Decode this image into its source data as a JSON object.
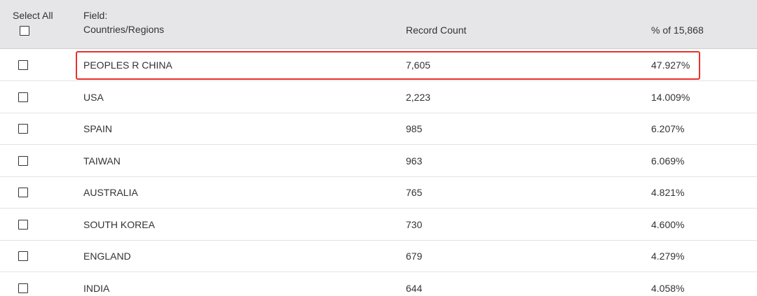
{
  "header": {
    "select_all": "Select All",
    "field_line1": "Field:",
    "field_line2": "Countries/Regions",
    "record_count": "Record Count",
    "percent": "% of 15,868"
  },
  "rows": [
    {
      "name": "PEOPLES R CHINA",
      "count": "7,605",
      "percent": "47.927%",
      "highlighted": true
    },
    {
      "name": "USA",
      "count": "2,223",
      "percent": "14.009%"
    },
    {
      "name": "SPAIN",
      "count": "985",
      "percent": "6.207%"
    },
    {
      "name": "TAIWAN",
      "count": "963",
      "percent": "6.069%"
    },
    {
      "name": "AUSTRALIA",
      "count": "765",
      "percent": "4.821%"
    },
    {
      "name": "SOUTH KOREA",
      "count": "730",
      "percent": "4.600%"
    },
    {
      "name": "ENGLAND",
      "count": "679",
      "percent": "4.279%"
    },
    {
      "name": "INDIA",
      "count": "644",
      "percent": "4.058%"
    }
  ],
  "colors": {
    "header_bg": "#e6e6e8",
    "highlight_border": "#e8302f",
    "text": "#333333"
  }
}
